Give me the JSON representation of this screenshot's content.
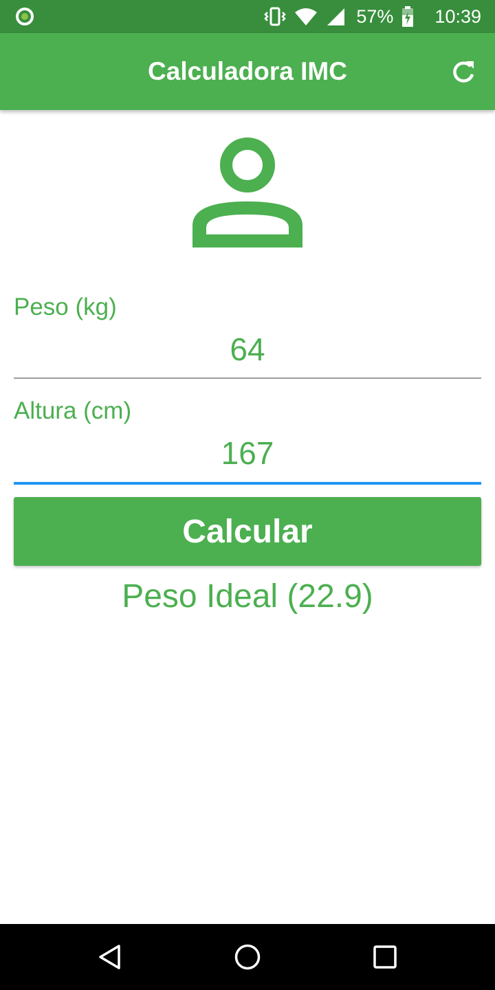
{
  "status_bar": {
    "battery": "57%",
    "time": "10:39",
    "icons": [
      "notification-dot-icon",
      "vibrate-icon",
      "wifi-icon",
      "cell-signal-icon",
      "battery-charging-icon"
    ]
  },
  "app_bar": {
    "title": "Calculadora IMC",
    "action_icon": "refresh-icon"
  },
  "main": {
    "avatar_icon": "person-icon",
    "weight_field": {
      "label": "Peso (kg)",
      "value": "64"
    },
    "height_field": {
      "label": "Altura (cm)",
      "value": "167",
      "focused": true
    },
    "calculate_button": "Calcular",
    "result": "Peso Ideal (22.9)"
  },
  "nav_bar": {
    "icons": [
      "back-icon",
      "home-icon",
      "recents-icon"
    ]
  },
  "colors": {
    "status_bar": "#388e3c",
    "primary": "#4caf50",
    "focus_underline": "#2196f3",
    "idle_underline": "#9e9e9e",
    "nav_bar": "#000000"
  }
}
